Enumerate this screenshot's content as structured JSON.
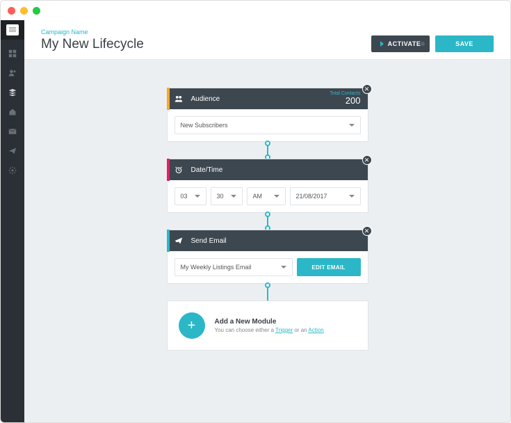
{
  "header": {
    "campaign_label": "Campaign Name",
    "title": "My New Lifecycle",
    "activate_label": "ACTIVATE",
    "save_label": "SAVE"
  },
  "modules": {
    "audience": {
      "title": "Audience",
      "contacts_label": "Total Contacts",
      "contacts_value": "200",
      "select_value": "New Subscribers"
    },
    "datetime": {
      "title": "Date/Time",
      "hour": "03",
      "minute": "30",
      "ampm": "AM",
      "date": "21/08/2017"
    },
    "sendemail": {
      "title": "Send Email",
      "select_value": "My Weekly Listings Email",
      "edit_label": "EDIT EMAIL"
    }
  },
  "add_module": {
    "title": "Add a New Module",
    "subtext_prefix": "You can choose either a ",
    "trigger_link": "Trigger",
    "subtext_mid": " or an ",
    "action_link": "Action"
  }
}
